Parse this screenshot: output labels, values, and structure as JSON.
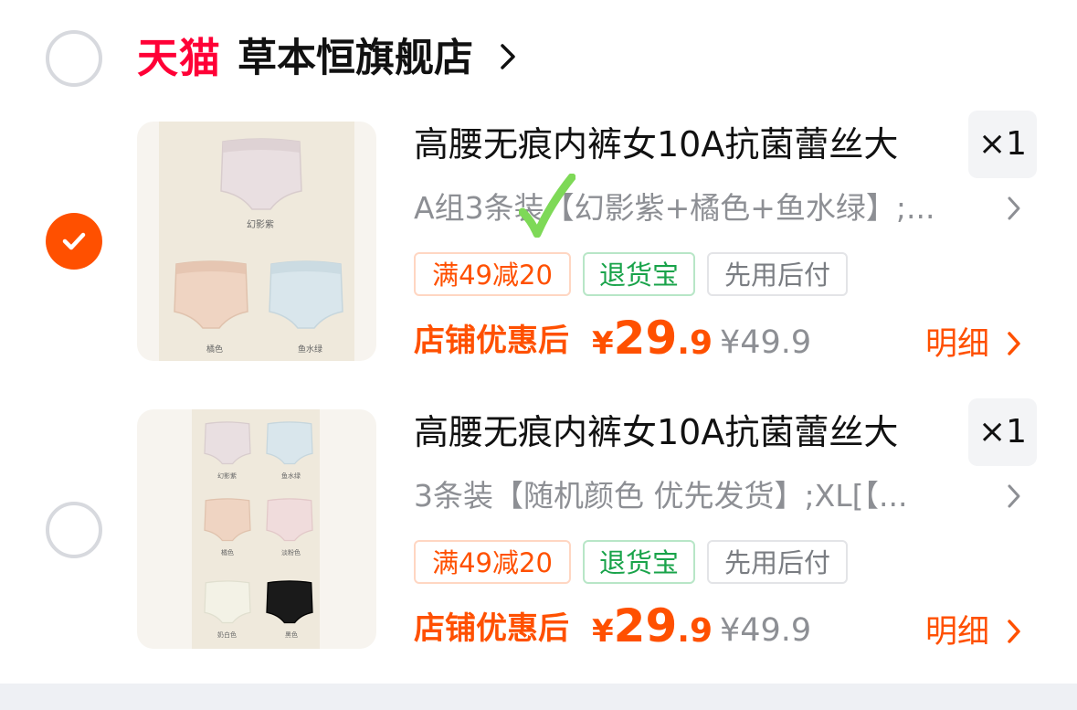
{
  "store": {
    "platform": "天猫",
    "name": "草本恒旗舰店",
    "chevron_icon": "chevron-right-icon"
  },
  "items": [
    {
      "selected": true,
      "thumb_labels": [
        "幻影紫",
        "橘色",
        "鱼水绿"
      ],
      "title": "高腰无痕内裤女10A抗菌蕾丝大",
      "qty": "×1",
      "sku": "A组3条装【幻影紫+橘色+鱼水绿】;...",
      "tags": [
        "满49减20",
        "退货宝",
        "先用后付"
      ],
      "price_label": "店铺优惠后",
      "price_currency": "¥",
      "price_int": "29",
      "price_dec": ".9",
      "price_original": "¥49.9",
      "detail_label": "明细"
    },
    {
      "selected": false,
      "thumb_labels": [
        "幻影紫",
        "鱼水绿",
        "橘色",
        "淡粉色",
        "奶白色",
        "黑色"
      ],
      "title": "高腰无痕内裤女10A抗菌蕾丝大",
      "qty": "×1",
      "sku": "3条装【随机颜色 优先发货】;XL[【...",
      "tags": [
        "满49减20",
        "退货宝",
        "先用后付"
      ],
      "price_label": "店铺优惠后",
      "price_currency": "¥",
      "price_int": "29",
      "price_dec": ".9",
      "price_original": "¥49.9",
      "detail_label": "明细"
    }
  ],
  "colors": {
    "accent": "#ff5000",
    "tmall_red": "#ff0036",
    "return_green": "#19a34a",
    "muted": "#8d8f94"
  }
}
